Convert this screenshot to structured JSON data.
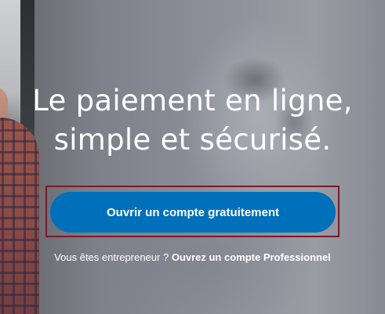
{
  "hero": {
    "headline_line1": "Le paiement en ligne,",
    "headline_line2": "simple et sécurisé.",
    "cta_label": "Ouvrir un compte gratuitement",
    "business_prompt": "Vous êtes entrepreneur ?",
    "business_link": "Ouvrez un compte Professionnel"
  },
  "colors": {
    "cta_background": "#0070ba",
    "highlight_border": "#7a1a28",
    "text": "#ffffff"
  }
}
